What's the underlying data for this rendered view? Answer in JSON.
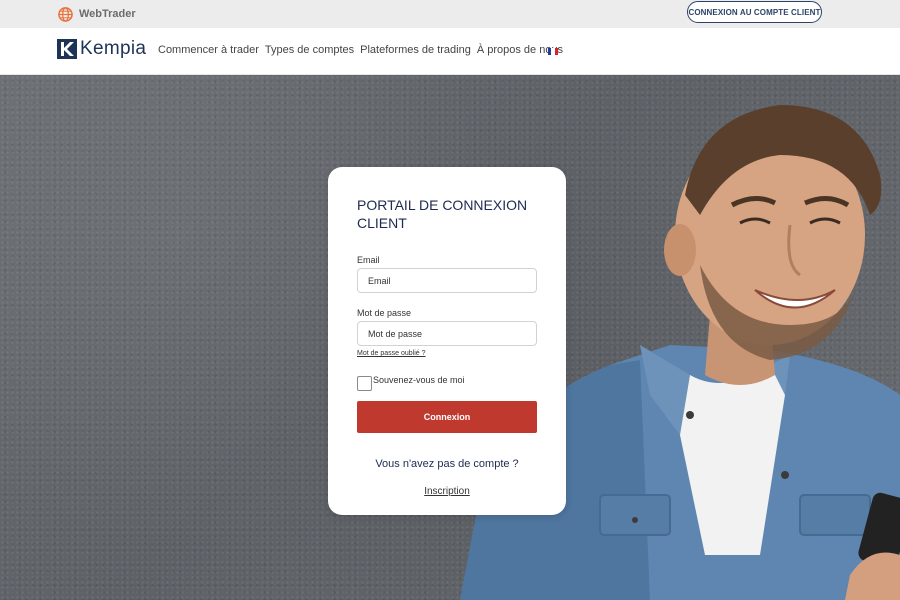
{
  "topbar": {
    "webtrader_label": "WebTrader",
    "client_login_button": "CONNEXION AU COMPTE CLIENT"
  },
  "navbar": {
    "logo_text": "Kempia",
    "links": [
      "Commencer à trader",
      "Types de comptes",
      "Plateformes de trading",
      "À propos de nous"
    ]
  },
  "login": {
    "title": "PORTAIL DE CONNEXION CLIENT",
    "email_label": "Email",
    "email_placeholder": "Email",
    "password_label": "Mot de passe",
    "password_placeholder": "Mot de passe",
    "forgot_password": "Mot de passe oublié ?",
    "remember_me": "Souvenez-vous de moi",
    "submit_label": "Connexion",
    "no_account_text": "Vous n'avez pas de compte ?",
    "signup_link": "Inscription"
  },
  "colors": {
    "brand_navy": "#1e3358",
    "primary_red": "#c0392f",
    "webtrader_orange": "#e8703a"
  },
  "icons": [
    "globe-icon",
    "french-flag-icon"
  ]
}
